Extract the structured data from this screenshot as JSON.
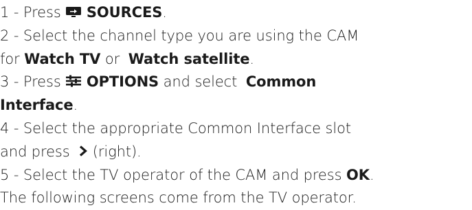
{
  "steps": [
    {
      "num": "1 -",
      "text_a": "Press",
      "icon": "sources-icon",
      "bold_a": "SOURCES",
      "text_b": "."
    },
    {
      "num": "2 -",
      "text_a": "Select the channel type you are using the CAM",
      "cont_a": "for",
      "bold_a": "Watch TV",
      "text_b": "or",
      "bold_b": "Watch satellite",
      "text_c": "."
    },
    {
      "num": "3 -",
      "text_a": "Press",
      "icon": "options-icon",
      "bold_a": "OPTIONS",
      "text_b": "and select",
      "bold_b": "Common",
      "bold_c": "Interface",
      "text_c": "."
    },
    {
      "num": "4 -",
      "text_a": "Select the appropriate Common Interface slot",
      "cont_a": "and press",
      "icon": "chevron-right-icon",
      "text_b": "(right)."
    },
    {
      "num": "5 -",
      "text_a": "Select the TV operator of the CAM and press",
      "bold_a": "OK",
      "text_b": "."
    }
  ],
  "footer": "The following screens come from the TV operator."
}
